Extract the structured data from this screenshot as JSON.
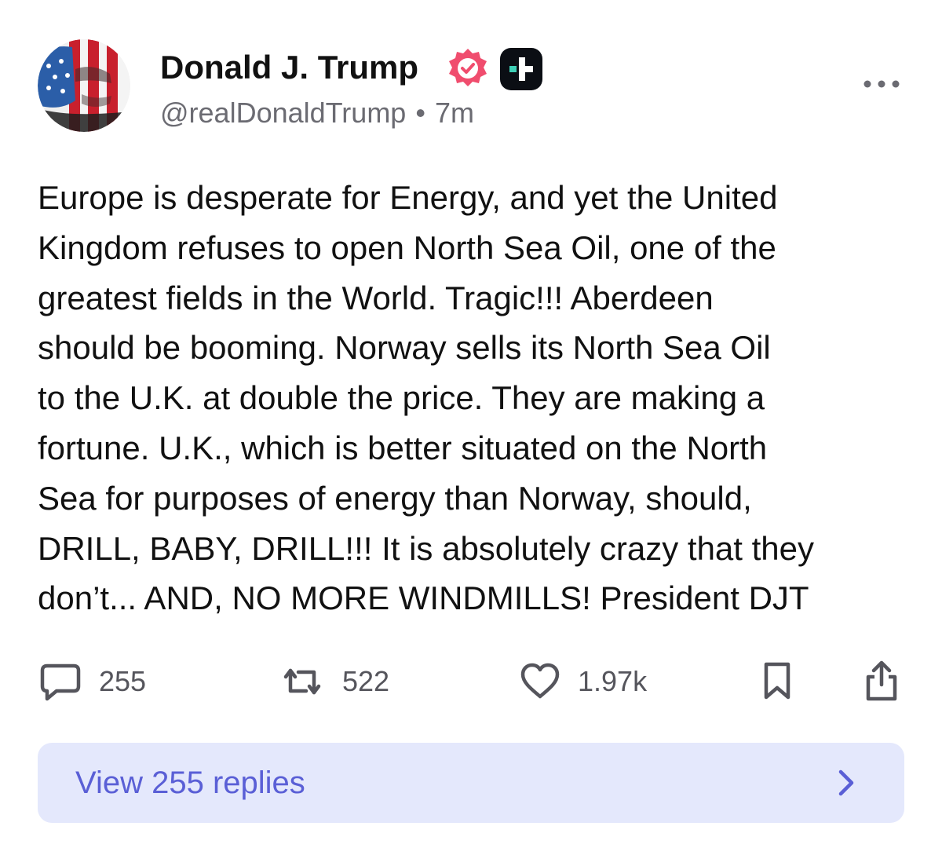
{
  "post": {
    "author": {
      "display_name": "Donald J. Trump",
      "handle": "@realDonaldTrump",
      "verified_icon": "verified-badge-icon",
      "plus_icon": "truth-plus-icon"
    },
    "separator": "•",
    "time_ago": "7m",
    "body": "Europe is desperate for Energy, and yet the United\nKingdom refuses to open North Sea Oil, one of the\ngreatest fields in the World. Tragic!!! Aberdeen\nshould be booming. Norway sells its North Sea Oil\nto the U.K. at double the price. They are making a\nfortune. U.K., which is better situated on the North\nSea for purposes of energy than Norway, should,\nDRILL, BABY, DRILL!!! It is absolutely crazy that they\ndon’t... AND, NO MORE WINDMILLS! President DJT",
    "actions": {
      "replies_count": "255",
      "retruths_count": "522",
      "likes_count": "1.97k"
    },
    "view_replies_label": "View 255 replies"
  },
  "colors": {
    "text_primary": "#111111",
    "text_secondary": "#6b6b72",
    "verified_badge": "#f04d6e",
    "plus_badge_bg": "#0b0e14",
    "plus_badge_accent": "#3ecfb6",
    "replies_bg": "#e4e8fc",
    "replies_text": "#5a5fd6"
  }
}
